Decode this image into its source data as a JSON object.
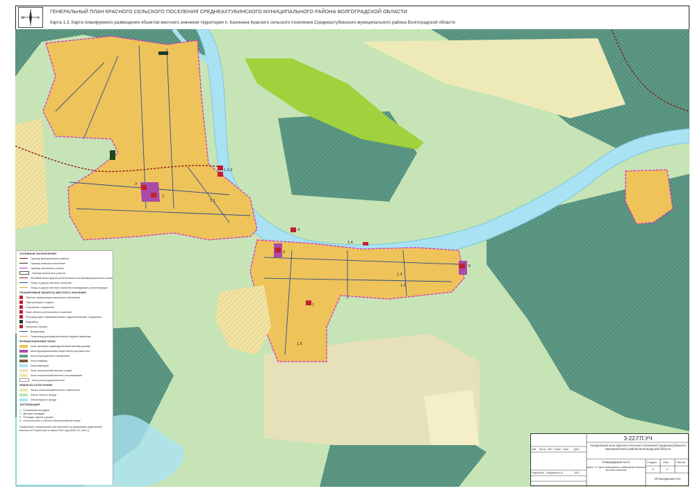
{
  "header": {
    "title": "ГЕНЕРАЛЬНЫЙ ПЛАН КРАСНОГО СЕЛЬСКОГО ПОСЕЛЕНИЯ СРЕДНЕАХТУБИНСКОГО МУНИЦИПАЛЬНОГО РАЙОНА ВОЛГОГРАДСКОЙ ОБЛАСТИ",
    "subtitle": "Карта 1.3.  Карта планируемого размещения объектов местного значения территории п. Калинина Красного сельского поселения Среднеахтубинского муниципального района Волгоградской области"
  },
  "compass": {
    "n": "N",
    "s": "S",
    "w": "W",
    "e": "E"
  },
  "labels": {
    "l132": "1.3.2",
    "l3": "3",
    "l2a": "2",
    "l11": "1.1",
    "l14": "1.4",
    "l2b": "2",
    "l13": "1.3",
    "l12": "1.2",
    "l1": "1",
    "l15": "1.5",
    "l6": "6",
    "l4": "4"
  },
  "legend": {
    "title": "УСЛОВНЫЕ ОБОЗНАЧЕНИЯ",
    "items1": [
      "Граница муниципального района",
      "Граница сельского поселения",
      "Граница населенного пункта",
      "Граница земельного участка",
      "Автомобильные дороги регионального или межмуниципального значения",
      "Улицы и дороги местного значения",
      "Улицы и дороги местного значения планируемые к реконструкции"
    ],
    "sec2": "ПЛАНИРУЕМЫЕ ОБЪЕКТЫ МЕСТНОГО ЗНАЧЕНИЯ",
    "items2": [
      "Объекты физкультурно-досугового назначения",
      "Парк культуры и отдыха",
      "Спортивное сооружение",
      "Иные объекты регионального значения",
      "Регулирующие и выправительные гидротехнические сооружения",
      "Водозабор",
      "Насосная станция",
      "Водопровод",
      "Газопровод распределительный среднего давления"
    ],
    "sec3": "ФУНКЦИОНАЛЬНЫЕ ЗОНЫ",
    "items3": [
      "Зона застройки индивидуальными жилыми домами",
      "Многофункциональная общественно-деловая зона",
      "Зона рекреационного назначения",
      "Зона кладбищ",
      "Зона акваторий",
      "Зона сельскохозяйственных угодий",
      "Зона сельскохозяйственного использования",
      "Зона улично-дорожной сети"
    ],
    "sec4": "ЗЕМЛИ ПО КАТЕГОРИЯМ",
    "items4": [
      "Земли сельскохозяйственного назначения",
      "Земли лесного фонда",
      "Земли водного фонда"
    ],
    "sec5": "ЭКСПЛИКАЦИЯ",
    "items5": [
      "1 - Спортивная площадка",
      "2 - Детская площадка",
      "3 - Площадь отдыха и досуга",
      "4 - Строительство и объекты благоустройства парка"
    ],
    "note": "Примечание: генеральный план выполнен на материалах кадастровой выписки из Росреестра от марта 2022 года (МСК 34, зона 2)"
  },
  "stamp": {
    "code": "3-22.ГП.УЧ",
    "project": "Генеральный план Красного сельского поселения Среднеахтубинского муниципального района Волгоградской области",
    "approved": "Утверждаемая часть",
    "caption": "Карта 1.3. Карта планируемого размещения объектов местного значения",
    "stage_h": "Стадия",
    "sheet_h": "Лист",
    "sheets_h": "Листов",
    "stage": "П",
    "sheet": "4",
    "cols": [
      "Изм.",
      "Кол.уч",
      "Лист",
      "№док",
      "Подп.",
      "Дата"
    ],
    "dev_label": "Разработал",
    "dev_name": "Богданенко К.И.",
    "year": "2022",
    "org": "ИП Богданенко К.И."
  },
  "colors": {
    "residential": "#eec35a",
    "water": "#a9e2f2",
    "forest": "#5f9d87",
    "green": "#c3e6b1",
    "agri": "#ebe5b8",
    "bright": "#9ed13c",
    "public": "#a94baa",
    "boundary": "#d22ec5",
    "road": "#2d4a8c"
  }
}
